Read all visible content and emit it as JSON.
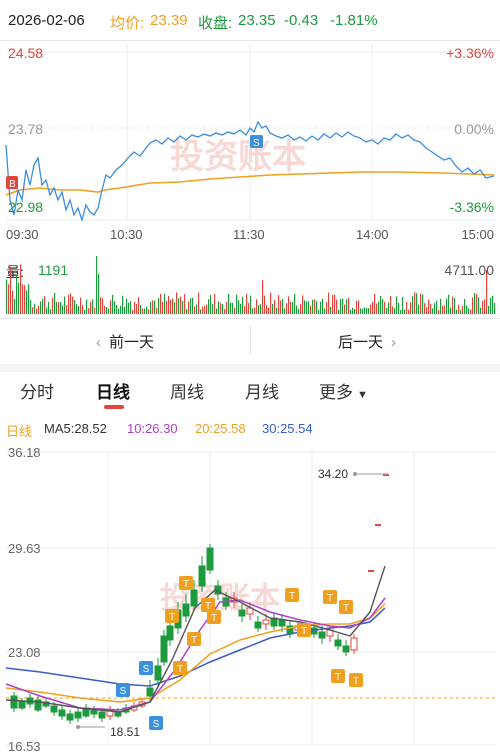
{
  "header": {
    "date": "2026-02-06",
    "avg_label": "均价:",
    "avg_value": "23.39",
    "close_label": "收盘:",
    "close_value": "23.35",
    "change": "-0.43",
    "change_pct": "-1.81%"
  },
  "colors": {
    "up": "#e0463d",
    "down": "#1e9a3e",
    "price_line": "#3a8fdf",
    "avg_line": "#f0a020",
    "accent": "#f0a020",
    "ma5": "#f0a020",
    "ma10": "#b040c8",
    "ma20": "#f0a020",
    "ma30": "#3a5cc8"
  },
  "intraday": {
    "y_high": "24.58",
    "y_mid": "23.78",
    "y_low": "22.98",
    "pct_high": "+3.36%",
    "pct_mid": "0.00%",
    "pct_low": "-3.36%",
    "times": [
      "09:30",
      "10:30",
      "11:30",
      "14:00",
      "15:00"
    ],
    "watermark": "投资账本",
    "buy_marker": "B",
    "sell_marker": "S"
  },
  "volume": {
    "label": "量:",
    "value": "1191",
    "max": "4711.00"
  },
  "nav": {
    "prev": "前一天",
    "next": "后一天"
  },
  "tabs": [
    {
      "label": "分时"
    },
    {
      "label": "日线"
    },
    {
      "label": "周线"
    },
    {
      "label": "月线"
    },
    {
      "label": "更多"
    }
  ],
  "kline": {
    "period": "日线",
    "ma5": "MA5:28.52",
    "ma10": "10:26.30",
    "ma20": "20:25.58",
    "ma30": "30:25.54",
    "y_labels": [
      "36.18",
      "29.63",
      "23.08",
      "16.53"
    ],
    "max_marker": "34.20",
    "min_marker": "18.51",
    "watermark": "投资账本",
    "markers": {
      "s": "S",
      "t": "T"
    }
  }
}
